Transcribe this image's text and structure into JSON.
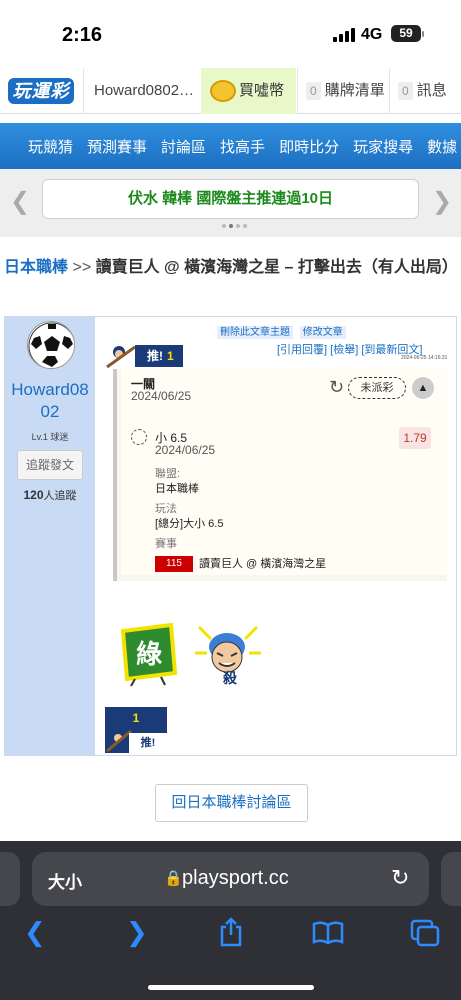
{
  "status": {
    "time": "2:16",
    "network": "4G",
    "battery": "59"
  },
  "header": {
    "logo": "玩運彩",
    "user": "Howard0802…",
    "buy": "買噓幣",
    "cart_count": "0",
    "cart": "購牌清單",
    "msg_count": "0",
    "msg": "訊息"
  },
  "nav": {
    "items": [
      "玩競猜",
      "預測賽事",
      "討論區",
      "找高手",
      "即時比分",
      "玩家搜尋",
      "數據"
    ]
  },
  "ticker": {
    "text": "伏水 韓棒 國際盤主推連過10日"
  },
  "breadcrumb": {
    "section": "日本職棒",
    "separator": ">>",
    "title": "讀賣巨人 @ 橫濱海灣之星 – 打擊出去（有人出局）"
  },
  "author": {
    "name": "Howard0802",
    "level": "Lv.1 球迷",
    "follow_button": "追蹤發文",
    "followers_count": "120",
    "followers_label": "人追蹤"
  },
  "post": {
    "admin_links": [
      "刪除此文章主題",
      "修改文章"
    ],
    "push_label": "推!",
    "push_count": "1",
    "reply_links": "[引用回覆] [檢舉] [到最新回文]",
    "posted_at": "2024-06-25 14:16:31"
  },
  "pick": {
    "title": "一關",
    "date": "2024/06/25",
    "status": "未派彩",
    "selection": "小 6.5",
    "selection_date": "2024/06/25",
    "odds": "1.79",
    "league_label": "聯盟:",
    "league": "日本職棒",
    "play_label": "玩法",
    "play": "[總分]大小 6.5",
    "game_label": "賽事",
    "game_id": "115",
    "game": "讀賣巨人 @ 橫濱海灣之星"
  },
  "stickers": {
    "green_label": "綠",
    "kill_label": "殺"
  },
  "push_bottom": {
    "count": "1",
    "label": "推!"
  },
  "back_button": "回日本職棒討論區",
  "browser": {
    "text_size": "大小",
    "domain": "playsport.cc"
  }
}
